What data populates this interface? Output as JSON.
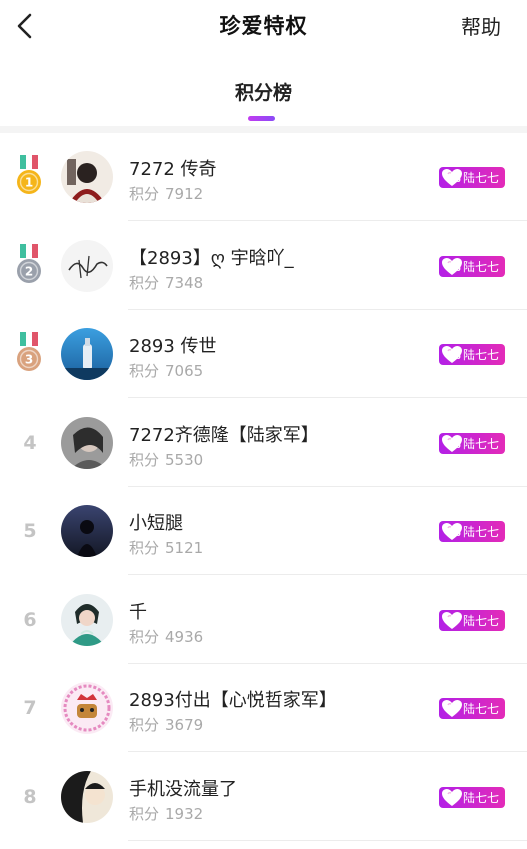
{
  "nav": {
    "title": "珍爱特权",
    "help_label": "帮助"
  },
  "tabs": {
    "active_label": "积分榜"
  },
  "colors": {
    "accent": "#c23bf0",
    "badge_start": "#b320e6",
    "badge_end": "#e32bb8",
    "gold": "#f5b51a",
    "silver": "#9aa0ab",
    "bronze": "#d9a27e"
  },
  "score_label": "积分",
  "ranking": [
    {
      "rank": "1",
      "medal": "gold",
      "name": "7272 传奇",
      "score": "7912",
      "badge_level": "10",
      "badge_name": "陆七七"
    },
    {
      "rank": "2",
      "medal": "silver",
      "name": "【2893】ღ 宇晗吖_",
      "score": "7348",
      "badge_level": "10",
      "badge_name": "陆七七"
    },
    {
      "rank": "3",
      "medal": "bronze",
      "name": "2893 传世",
      "score": "7065",
      "badge_level": "10",
      "badge_name": "陆七七"
    },
    {
      "rank": "4",
      "medal": "",
      "name": "7272齐德隆【陆家军】",
      "score": "5530",
      "badge_level": "10",
      "badge_name": "陆七七"
    },
    {
      "rank": "5",
      "medal": "",
      "name": "小短腿",
      "score": "5121",
      "badge_level": "10",
      "badge_name": "陆七七"
    },
    {
      "rank": "6",
      "medal": "",
      "name": "千",
      "score": "4936",
      "badge_level": "9",
      "badge_name": "陆七七"
    },
    {
      "rank": "7",
      "medal": "",
      "name": "2893付出【心悦哲家军】",
      "score": "3679",
      "badge_level": "9",
      "badge_name": "陆七七"
    },
    {
      "rank": "8",
      "medal": "",
      "name": "手机没流量了",
      "score": "1932",
      "badge_level": "8",
      "badge_name": "陆七七"
    }
  ]
}
